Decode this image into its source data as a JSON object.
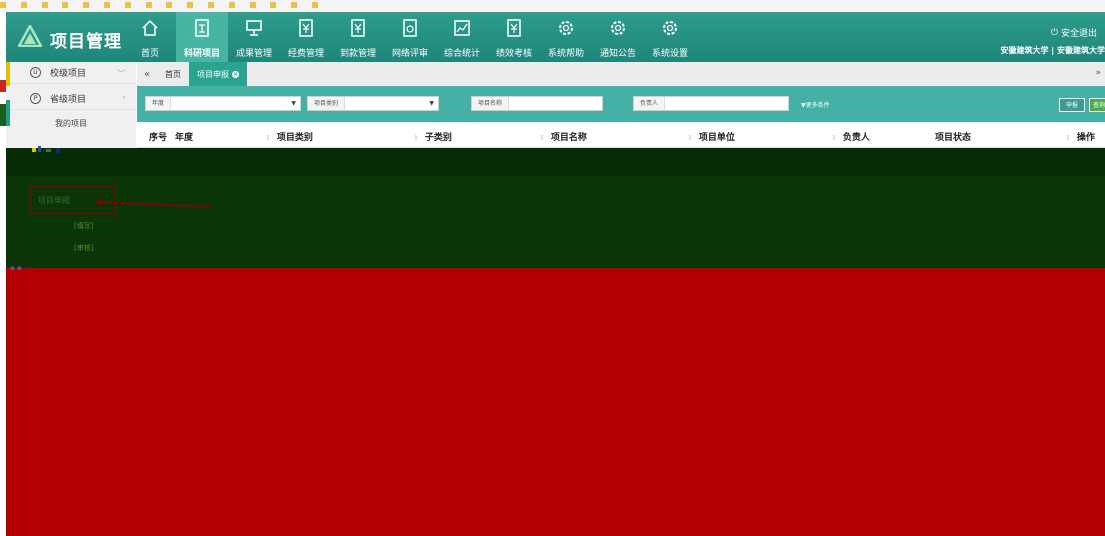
{
  "app": {
    "title": "项目管理",
    "logout_label": "安全退出",
    "user_line": "安徽建筑大学 | 安徽建筑大学"
  },
  "colors": {
    "header": "#2e9c8c",
    "accent": "#44b0a6",
    "overlay_green": "#0b3407",
    "overlay_red": "#b20000"
  },
  "nav": [
    {
      "label": "首页",
      "icon": "home-icon"
    },
    {
      "label": "科研项目",
      "icon": "project-doc-icon"
    },
    {
      "label": "成果管理",
      "icon": "presentation-icon"
    },
    {
      "label": "经费管理",
      "icon": "yuan-doc-icon"
    },
    {
      "label": "到款管理",
      "icon": "yuan-doc-icon"
    },
    {
      "label": "网络评审",
      "icon": "review-icon"
    },
    {
      "label": "综合统计",
      "icon": "chart-icon"
    },
    {
      "label": "绩效考核",
      "icon": "yuan-doc-icon"
    },
    {
      "label": "系统帮助",
      "icon": "gear-icon"
    },
    {
      "label": "通知公告",
      "icon": "gear-icon"
    },
    {
      "label": "系统设置",
      "icon": "gear-icon"
    }
  ],
  "sidebar": {
    "items": [
      {
        "label": "校级项目",
        "glyph": "U"
      },
      {
        "label": "省级项目",
        "glyph": "P"
      }
    ],
    "sub_item": "我的项目"
  },
  "tabs": {
    "home": "首页",
    "active": "项目申报"
  },
  "filters": {
    "year_label": "年度",
    "category_label": "项目类别",
    "name_label": "项目名称",
    "owner_label": "负责人",
    "more_label": "更多条件",
    "apply_label": "申报",
    "search_label": "查询"
  },
  "table": {
    "columns": [
      "序号",
      "年度",
      "项目类别",
      "子类别",
      "项目名称",
      "项目单位",
      "负责人",
      "项目状态",
      "操作"
    ]
  },
  "overlay": {
    "highlight_label": "项目申报",
    "mini_a": "[填写]",
    "mini_b": "[审核]"
  }
}
